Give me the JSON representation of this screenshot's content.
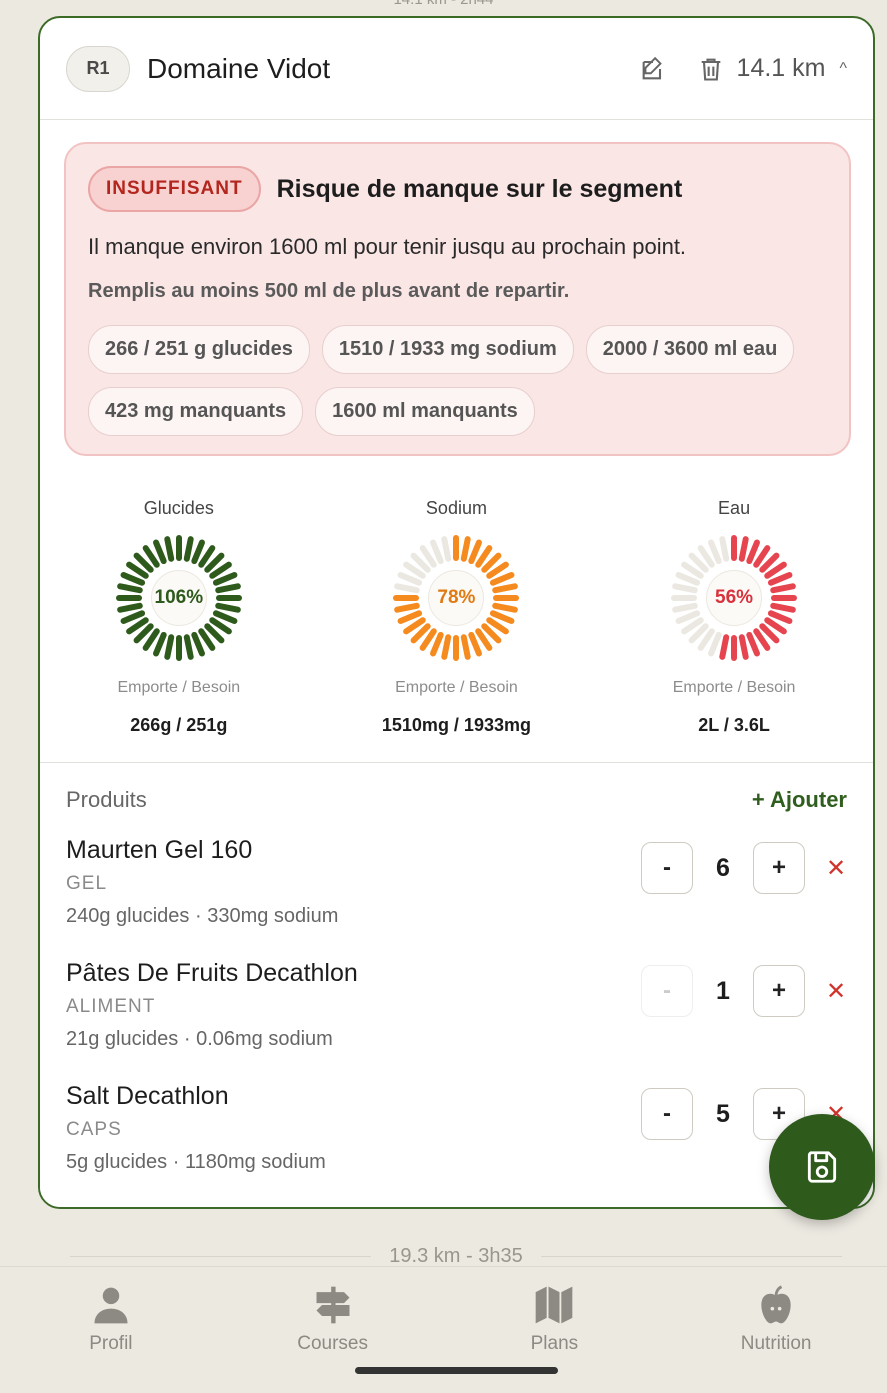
{
  "top_segment_fragment": "14.1 km - 2h44",
  "stop": {
    "badge": "R1",
    "name": "Domaine Vidot",
    "distance": "14.1 km",
    "edit_icon": "edit-icon",
    "delete_icon": "trash-icon",
    "collapse_icon": "chevron-up-icon"
  },
  "alert": {
    "status": "INSUFFISANT",
    "title": "Risque de manque sur le segment",
    "message": "Il manque environ 1600 ml pour tenir jusqu au prochain point.",
    "advice": "Remplis au moins 500 ml de plus avant de repartir.",
    "chips": [
      "266 / 251 g glucides",
      "1510 / 1933 mg sodium",
      "2000 / 3600 ml eau",
      "423 mg manquants",
      "1600 ml manquants"
    ],
    "colors": {
      "background": "#fbe6e6",
      "status": "#b3261e"
    }
  },
  "gauges": [
    {
      "label": "Glucides",
      "percent": 106,
      "percent_text": "106%",
      "sub": "Emporte / Besoin",
      "value": "266g / 251g",
      "color": "#2e5a1c",
      "text_color": "#2e5a1c"
    },
    {
      "label": "Sodium",
      "percent": 78,
      "percent_text": "78%",
      "sub": "Emporte / Besoin",
      "value": "1510mg / 1933mg",
      "color": "#f58a1f",
      "text_color": "#e07a12"
    },
    {
      "label": "Eau",
      "percent": 56,
      "percent_text": "56%",
      "sub": "Emporte / Besoin",
      "value": "2L / 3.6L",
      "color": "#e6454f",
      "text_color": "#d9323c"
    }
  ],
  "products": {
    "title": "Produits",
    "add_label": "+ Ajouter",
    "items": [
      {
        "name": "Maurten Gel 160",
        "category": "GEL",
        "info": "240g glucides · 330mg sodium",
        "qty": "6",
        "minus_enabled": true
      },
      {
        "name": "Pâtes De Fruits Decathlon",
        "category": "ALIMENT",
        "info": "21g glucides · 0.06mg sodium",
        "qty": "1",
        "minus_enabled": false
      },
      {
        "name": "Salt Decathlon",
        "category": "CAPS",
        "info": "5g glucides · 1180mg sodium",
        "qty": "5",
        "minus_enabled": true
      }
    ],
    "minus_label": "-",
    "plus_label": "+",
    "remove_label": "✕"
  },
  "save_icon": "save-icon",
  "next_segment": "19.3 km - 3h35",
  "tabs": [
    {
      "label": "Profil",
      "icon": "person-icon"
    },
    {
      "label": "Courses",
      "icon": "signpost-icon"
    },
    {
      "label": "Plans",
      "icon": "map-icon"
    },
    {
      "label": "Nutrition",
      "icon": "apple-icon"
    }
  ],
  "brand_color": "#2e5a1c"
}
